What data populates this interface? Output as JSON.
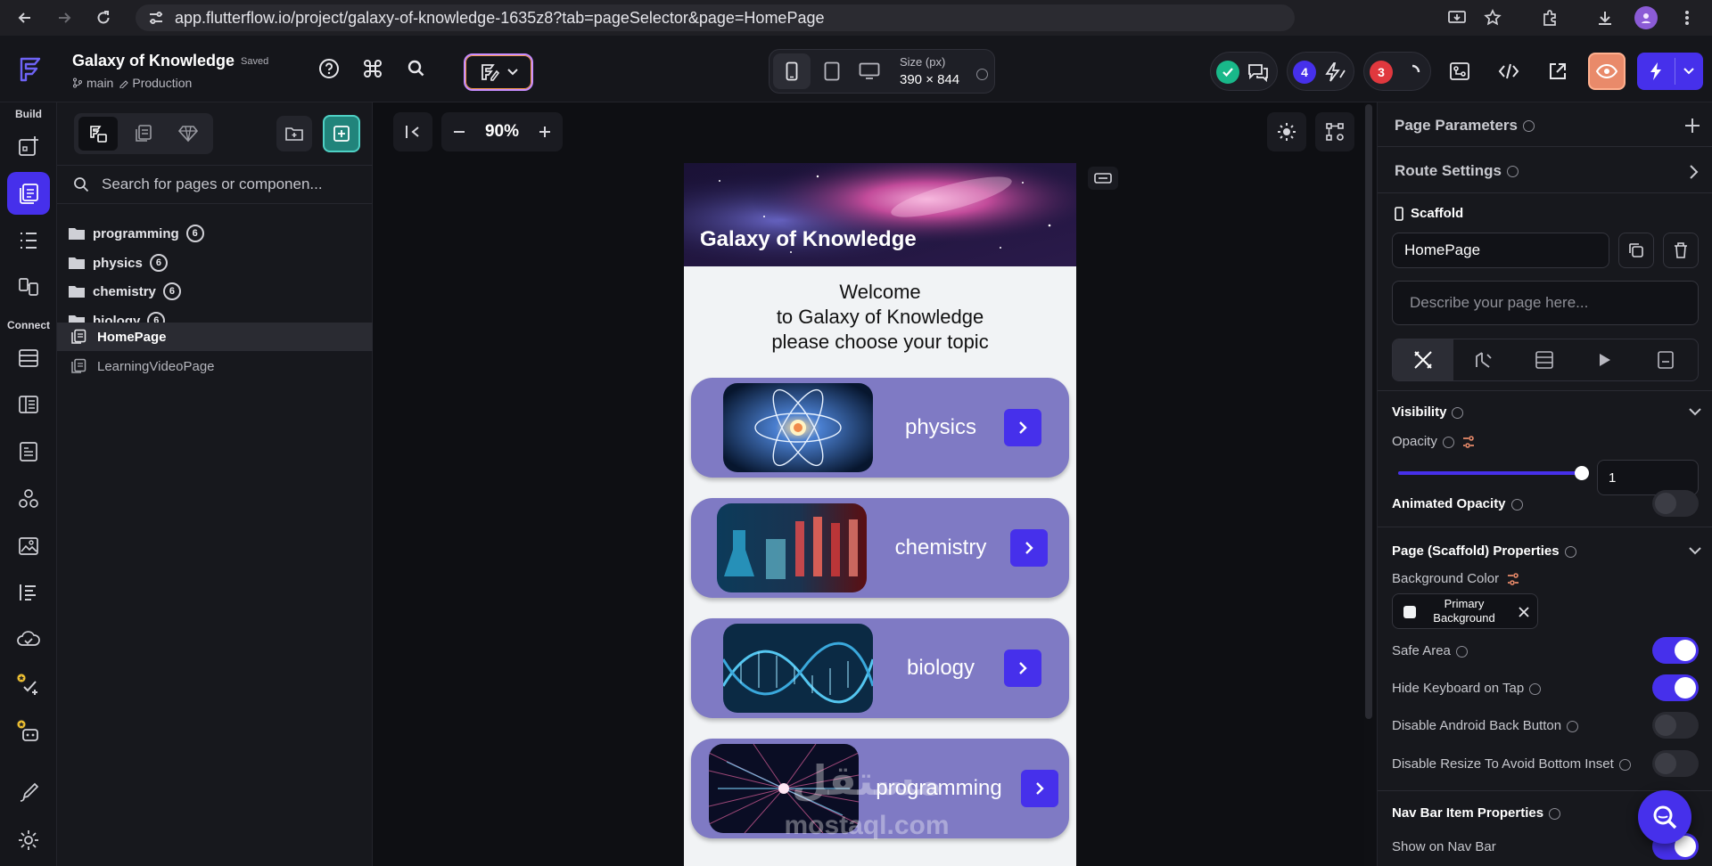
{
  "browser": {
    "url": "app.flutterflow.io/project/galaxy-of-knowledge-1635z8?tab=pageSelector&page=HomePage"
  },
  "header": {
    "project_name": "Galaxy of Knowledge",
    "save_state": "Saved",
    "branch": "main",
    "environment": "Production",
    "size_label": "Size (px)",
    "size_value": "390 × 844",
    "issues_count": "4",
    "errors_count": "3"
  },
  "rail": {
    "build_label": "Build",
    "connect_label": "Connect"
  },
  "panel": {
    "search_placeholder": "Search for pages or componen...",
    "folders": [
      {
        "name": "programming",
        "count": "6"
      },
      {
        "name": "physics",
        "count": "6"
      },
      {
        "name": "chemistry",
        "count": "6"
      },
      {
        "name": "biology",
        "count": "6"
      }
    ],
    "pages": [
      {
        "name": "HomePage"
      },
      {
        "name": "LearningVideoPage"
      }
    ]
  },
  "canvas": {
    "zoom": "90%"
  },
  "phone": {
    "hero_title": "Galaxy of Knowledge",
    "welcome_line1": "Welcome",
    "welcome_line2": "to Galaxy of Knowledge",
    "welcome_line3": "please choose your topic",
    "cards": [
      {
        "label": "physics"
      },
      {
        "label": "chemistry"
      },
      {
        "label": "biology"
      },
      {
        "label": "programming"
      }
    ],
    "watermark_line1": "مستقل",
    "watermark_line2": "mostaql.com"
  },
  "props": {
    "page_parameters": "Page Parameters",
    "route_settings": "Route Settings",
    "scaffold": "Scaffold",
    "page_name": "HomePage",
    "describe_placeholder": "Describe your page here...",
    "visibility": "Visibility",
    "opacity_label": "Opacity",
    "opacity_value": "1",
    "opacity_level": 1,
    "animated_opacity": "Animated Opacity",
    "scaffold_props": "Page (Scaffold) Properties",
    "background_color_label": "Background Color",
    "background_color_line1": "Primary",
    "background_color_line2": "Background",
    "safe_area": "Safe Area",
    "hide_keyboard": "Hide Keyboard on Tap",
    "disable_back": "Disable Android Back Button",
    "disable_resize": "Disable Resize To Avoid Bottom Inset",
    "nav_bar_props": "Nav Bar Item Properties",
    "show_nav_bar": "Show on Nav Bar"
  },
  "colors": {
    "accent": "#4630eb",
    "card": "#7f7ac4",
    "success": "#19b88a",
    "error": "#e0383e"
  }
}
